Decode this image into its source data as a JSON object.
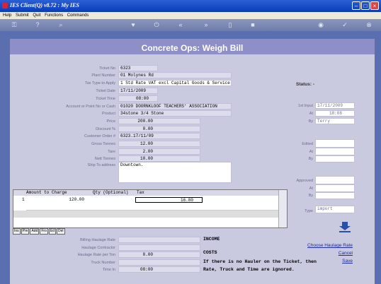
{
  "window": {
    "title": "IES Client(Q) v8.72 : My IES"
  },
  "menu": [
    "Help",
    "Submit",
    "Quit",
    "Functions",
    "Commands"
  ],
  "page_title": "Concrete Ops: Weigh Bill",
  "form": {
    "ticket_no": {
      "label": "Ticket No",
      "value": "6323"
    },
    "plant_number": {
      "label": "Plant Number",
      "value": "01 Molynes Rd"
    },
    "tax_type": {
      "label": "Tax Type to Apply",
      "value": "1 Std Rate VAT excl Capital Goods & Service"
    },
    "ticket_date": {
      "label": "Ticket Date",
      "value": "17/11/2009"
    },
    "ticket_time": {
      "label": "Ticket Time",
      "value": "08:00"
    },
    "account": {
      "label": "Account or Point No or Cash",
      "value": "01020 DOORNKLOOF TEACHERS' ASSOCIATION"
    },
    "product": {
      "label": "Product",
      "value": "34stone 3/4 Stone"
    },
    "price": {
      "label": "Price",
      "value": "200.00"
    },
    "discount": {
      "label": "Discount %",
      "value": "0.00"
    },
    "customer_order": {
      "label": "Customer Order #",
      "value": "6323.17/11/09"
    },
    "gross_tonnes": {
      "label": "Gross Tonnes",
      "value": "12.00"
    },
    "tare": {
      "label": "Tare",
      "value": "2.00"
    },
    "nett_tonnes": {
      "label": "Nett Tonnes",
      "value": "10.00"
    },
    "ship_to": {
      "label": "Ship To address",
      "value": "Downtown."
    }
  },
  "status": {
    "label": "Status:",
    "value": "-"
  },
  "right": {
    "first_input": {
      "label": "1st Input",
      "value": "17/11/2009"
    },
    "at1": {
      "label": "At",
      "value": "18:08"
    },
    "by1": {
      "label": "By",
      "value": "Terry"
    },
    "edited": {
      "label": "Edited",
      "value": ""
    },
    "at2": {
      "label": "At",
      "value": ""
    },
    "by2": {
      "label": "By",
      "value": ""
    },
    "approved": {
      "label": "Approved",
      "value": ""
    },
    "at3": {
      "label": "At",
      "value": ""
    },
    "by3": {
      "label": "By",
      "value": ""
    },
    "type": {
      "label": "Type",
      "value": "import"
    }
  },
  "grid": {
    "headers": [
      "Amount to Charge",
      "Qty (Optional)",
      "Tax"
    ],
    "rows": [
      {
        "num": "1",
        "amount": "120.00",
        "qty": "",
        "tax": "16.80"
      }
    ],
    "buttons": [
      "Ins",
      "Pre",
      "Add",
      "Fro",
      "Ed",
      "Del"
    ]
  },
  "haulage": {
    "billing_rate": {
      "label": "Billing Haulage Rate",
      "value": ""
    },
    "contractor": {
      "label": "Haulage Contractor",
      "value": ""
    },
    "rate_per_ton": {
      "label": "Haulage Rate per Ton",
      "value": "0.00"
    },
    "truck_number": {
      "label": "Truck Number",
      "value": ""
    },
    "time_in": {
      "label": "Time In",
      "value": "08:00"
    }
  },
  "notes": {
    "income": "INCOME",
    "costs": "COSTS",
    "line1": "If there is no Hauler on the Ticket, then",
    "line2": "Rate, Truck and Time are ignored."
  },
  "links": {
    "choose": "Choose Haulage Rate",
    "cancel": "Cancel",
    "save": "Save"
  }
}
